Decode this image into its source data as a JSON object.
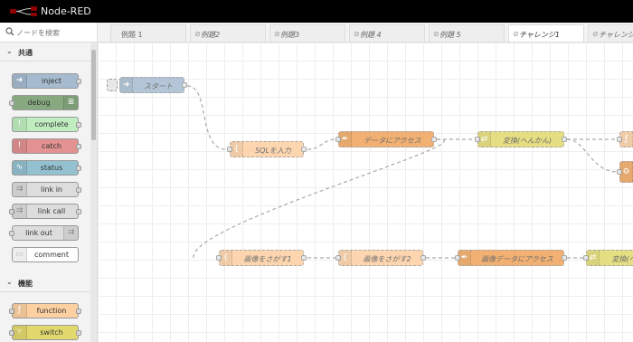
{
  "header": {
    "app_title": "Node-RED"
  },
  "palette": {
    "search_placeholder": "ノードを検索",
    "categories": [
      {
        "label": "共通"
      },
      {
        "label": "機能"
      }
    ],
    "nodes": [
      {
        "label": "inject",
        "color": "#a6bbcf",
        "icon": "arrow-right-icon"
      },
      {
        "label": "debug",
        "color": "#87a980",
        "icon": "list-icon"
      },
      {
        "label": "complete",
        "color": "#c0edc0",
        "icon": "exclamation-icon"
      },
      {
        "label": "catch",
        "color": "#e49191",
        "icon": "exclamation-icon"
      },
      {
        "label": "status",
        "color": "#94c1d0",
        "icon": "pulse-icon"
      },
      {
        "label": "link in",
        "color": "#dddddd",
        "icon": "link-icon"
      },
      {
        "label": "link call",
        "color": "#dddddd",
        "icon": "link-icon"
      },
      {
        "label": "link out",
        "color": "#dddddd",
        "icon": "link-icon"
      },
      {
        "label": "comment",
        "color": "#ffffff",
        "icon": "comment-icon"
      },
      {
        "label": "function",
        "color": "#fdd0a2",
        "icon": "function-icon"
      },
      {
        "label": "switch",
        "color": "#e2d96e",
        "icon": "switch-icon"
      }
    ]
  },
  "tabs": [
    {
      "label": "例題 1",
      "disabled": false
    },
    {
      "label": "例題2",
      "disabled": true
    },
    {
      "label": "例題3",
      "disabled": true
    },
    {
      "label": "例題 4",
      "disabled": true
    },
    {
      "label": "例題 5",
      "disabled": true
    },
    {
      "label": "チャレンジ1",
      "disabled": true
    },
    {
      "label": "チャレンジ",
      "disabled": true
    }
  ],
  "flow": {
    "nodes": [
      {
        "label": "スタート",
        "color": "#a6bbcf",
        "icon": "arrow-right-icon"
      },
      {
        "label": "SQLを入力",
        "color": "#fdd0a2",
        "icon": "template-icon"
      },
      {
        "label": "データにアクセス",
        "color": "#f0a35a",
        "icon": "feather-icon"
      },
      {
        "label": "変換(へんかん)",
        "color": "#e2d96e",
        "icon": "convert-icon"
      },
      {
        "label": "画像をさがす1",
        "color": "#fdd0a2",
        "icon": "template-icon"
      },
      {
        "label": "画像をさがす2",
        "color": "#fdd0a2",
        "icon": "template-icon"
      },
      {
        "label": "画像データにアクセス",
        "color": "#f0a35a",
        "icon": "feather-icon"
      },
      {
        "label": "変換(へ",
        "color": "#e2d96e",
        "icon": "convert-icon"
      },
      {
        "label": "",
        "color": "#fdd0a2",
        "icon": "function-icon"
      },
      {
        "label": "",
        "color": "#f0a35a",
        "icon": "gear-icon"
      }
    ]
  }
}
